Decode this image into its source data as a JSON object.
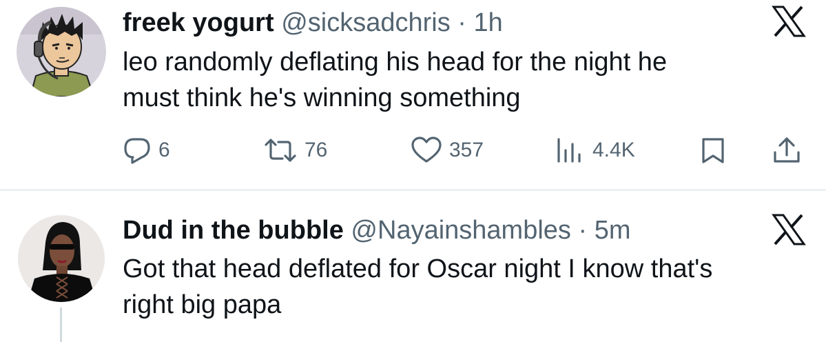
{
  "tweets": [
    {
      "display_name": "freek yogurt",
      "handle": "@sicksadchris",
      "separator": "·",
      "time": "1h",
      "text_line1": "leo randomly deflating his head for the night he",
      "text_line2": "must think he's winning something",
      "platform_icon": "x-logo-icon",
      "avatar_icon": "cartoon-avatar",
      "actions": {
        "replies": "6",
        "reposts": "76",
        "likes": "357",
        "views": "4.4K"
      }
    },
    {
      "display_name": "Dud in the bubble",
      "handle": "@Nayainshambles",
      "separator": "·",
      "time": "5m",
      "text_line1": "Got that head deflated for Oscar night I know that's",
      "text_line2": "right big papa",
      "platform_icon": "x-logo-icon",
      "avatar_icon": "photo-avatar"
    }
  ],
  "colors": {
    "text": "#0f1419",
    "secondary": "#536471",
    "divider": "#cfd9de"
  }
}
